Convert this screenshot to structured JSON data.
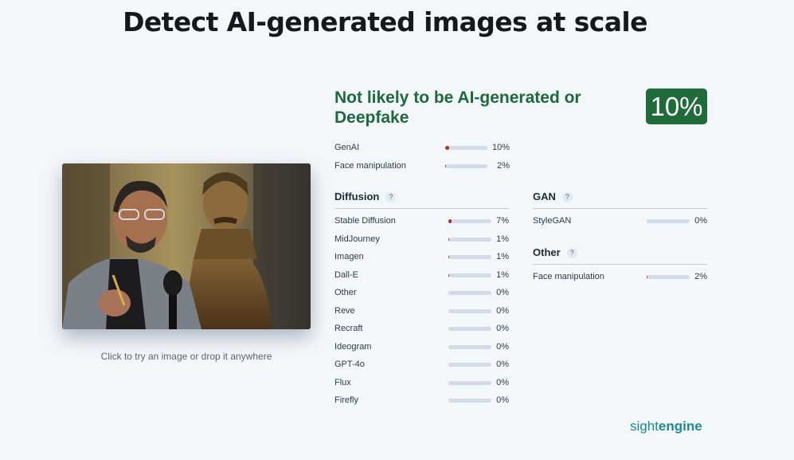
{
  "header": {
    "title": "Detect AI-generated images at scale"
  },
  "upload": {
    "caption": "Click to try an image or drop it anywhere"
  },
  "result": {
    "verdict": "Not likely to be AI-generated or Deepfake",
    "score": "10%",
    "score_value": 0.1,
    "summary": [
      {
        "label": "GenAI",
        "value": 0.1,
        "pct": "10%"
      },
      {
        "label": "Face manipulation",
        "value": 0.02,
        "pct": "2%"
      }
    ]
  },
  "diffusion": {
    "title": "Diffusion",
    "help": "?",
    "items": [
      {
        "label": "Stable Diffusion",
        "value": 0.07,
        "pct": "7%"
      },
      {
        "label": "MidJourney",
        "value": 0.01,
        "pct": "1%"
      },
      {
        "label": "Imagen",
        "value": 0.01,
        "pct": "1%"
      },
      {
        "label": "Dall-E",
        "value": 0.01,
        "pct": "1%"
      },
      {
        "label": "Other",
        "value": 0,
        "pct": "0%"
      },
      {
        "label": "Reve",
        "value": 0,
        "pct": "0%"
      },
      {
        "label": "Recraft",
        "value": 0,
        "pct": "0%"
      },
      {
        "label": "Ideogram",
        "value": 0,
        "pct": "0%"
      },
      {
        "label": "GPT-4o",
        "value": 0,
        "pct": "0%"
      },
      {
        "label": "Flux",
        "value": 0,
        "pct": "0%"
      },
      {
        "label": "Firefly",
        "value": 0,
        "pct": "0%"
      }
    ]
  },
  "gan": {
    "title": "GAN",
    "help": "?",
    "items": [
      {
        "label": "StyleGAN",
        "value": 0,
        "pct": "0%"
      }
    ]
  },
  "other": {
    "title": "Other",
    "help": "?",
    "items": [
      {
        "label": "Face manipulation",
        "value": 0.02,
        "pct": "2%"
      }
    ]
  },
  "brand": {
    "light": "sight",
    "bold": "engine"
  },
  "colors": {
    "accent": "#1f6b3a",
    "bar_fill": "#b8262f",
    "bar_track": "#d4dbe6",
    "brand": "#1a8a97"
  }
}
